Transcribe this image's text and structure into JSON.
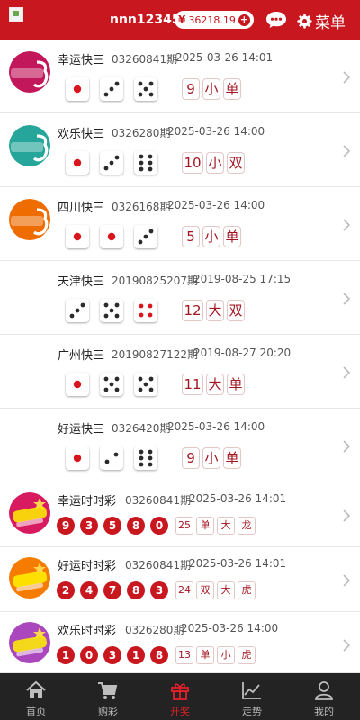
{
  "header": {
    "username": "nnn123456",
    "currency_symbol": "¥",
    "balance": "36218.19",
    "menu_label": "菜单",
    "bg_color": "#c9171f"
  },
  "lotteries": [
    {
      "logo": "KUAISAN 幸运快3",
      "name": "幸运快三",
      "issue": "03260841期",
      "time": "2025-03-26 14:01",
      "dice": [
        1,
        3,
        5
      ],
      "sum": "9",
      "size": "小",
      "parity": "单"
    },
    {
      "logo": "KUAISAN 欢乐快3",
      "name": "欢乐快三",
      "issue": "0326280期",
      "time": "2025-03-26 14:00",
      "dice": [
        1,
        3,
        6
      ],
      "sum": "10",
      "size": "小",
      "parity": "双"
    },
    {
      "logo": "KUAISAN 四川快3",
      "name": "四川快三",
      "issue": "0326168期",
      "time": "2025-03-26 14:00",
      "dice": [
        1,
        1,
        3
      ],
      "sum": "5",
      "size": "小",
      "parity": "单"
    },
    {
      "logo": "",
      "name": "天津快三",
      "issue": "20190825207期",
      "time": "2019-08-25 17:15",
      "dice": [
        3,
        5,
        4
      ],
      "sum": "12",
      "size": "大",
      "parity": "双"
    },
    {
      "logo": "",
      "name": "广州快三",
      "issue": "20190827122期",
      "time": "2019-08-27 20:20",
      "dice": [
        1,
        5,
        5
      ],
      "sum": "11",
      "size": "大",
      "parity": "单"
    },
    {
      "logo": "",
      "name": "好运快三",
      "issue": "0326420期",
      "time": "2025-03-26 14:00",
      "dice": [
        1,
        2,
        6
      ],
      "sum": "9",
      "size": "小",
      "parity": "单"
    }
  ],
  "ssc": [
    {
      "logo": "幸运 时时彩 LOTTERY",
      "name": "幸运时时彩",
      "issue": "03260841期",
      "time": "2025-03-26 14:01",
      "balls": [
        "9",
        "3",
        "5",
        "8",
        "0"
      ],
      "sum": "25",
      "parity": "单",
      "size": "大",
      "dragon": "龙"
    },
    {
      "logo": "好运 时时彩 LOTTERY",
      "name": "好运时时彩",
      "issue": "03260841期",
      "time": "2025-03-26 14:01",
      "balls": [
        "2",
        "4",
        "7",
        "8",
        "3"
      ],
      "sum": "24",
      "parity": "双",
      "size": "大",
      "dragon": "虎"
    },
    {
      "logo": "欢乐 时时彩 LOTTERY",
      "name": "欢乐时时彩",
      "issue": "0326280期",
      "time": "2025-03-26 14:00",
      "balls": [
        "1",
        "0",
        "3",
        "1",
        "8"
      ],
      "sum": "13",
      "parity": "单",
      "size": "小",
      "dragon": "虎"
    }
  ],
  "nav": [
    {
      "label": "首页",
      "icon": "home-icon"
    },
    {
      "label": "购彩",
      "icon": "cart-icon"
    },
    {
      "label": "开奖",
      "icon": "gift-icon",
      "active": true
    },
    {
      "label": "走势",
      "icon": "trend-icon"
    },
    {
      "label": "我的",
      "icon": "user-icon"
    }
  ]
}
